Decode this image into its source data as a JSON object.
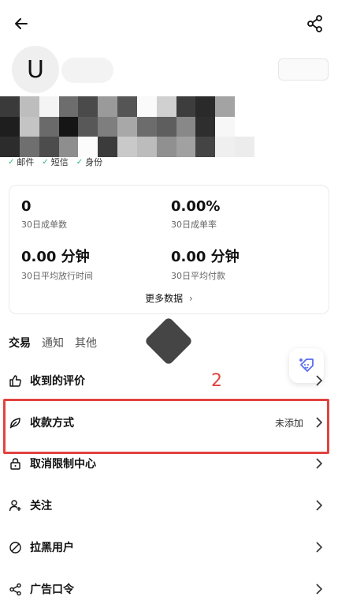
{
  "header": {
    "back_icon": "arrow-left-icon",
    "share_icon": "share-icon"
  },
  "profile": {
    "avatar_letter": "U",
    "verifications": [
      {
        "label": "邮件"
      },
      {
        "label": "短信"
      },
      {
        "label": "身份"
      }
    ]
  },
  "stats": {
    "items": [
      {
        "value": "0",
        "label": "30日成单数"
      },
      {
        "value": "0.00%",
        "label": "30日成单率"
      },
      {
        "value": "0.00 分钟",
        "label": "30日平均放行时间"
      },
      {
        "value": "0.00 分钟",
        "label": "30日平均付款"
      }
    ],
    "more_label": "更多数据"
  },
  "tabs": [
    {
      "label": "交易",
      "active": true
    },
    {
      "label": "通知",
      "active": false
    },
    {
      "label": "其他",
      "active": false
    }
  ],
  "annotation": {
    "number": "2",
    "color": "#e2433f"
  },
  "menu": [
    {
      "label": "收到的评价",
      "icon": "thumbs-up-icon",
      "value": ""
    },
    {
      "label": "收款方式",
      "icon": "payment-leaf-icon",
      "value": "未添加"
    },
    {
      "label": "取消限制中心",
      "icon": "lock-icon",
      "value": ""
    },
    {
      "label": "关注",
      "icon": "user-add-icon",
      "value": ""
    },
    {
      "label": "拉黑用户",
      "icon": "block-icon",
      "value": ""
    },
    {
      "label": "广告口令",
      "icon": "share-nodes-icon",
      "value": ""
    }
  ]
}
